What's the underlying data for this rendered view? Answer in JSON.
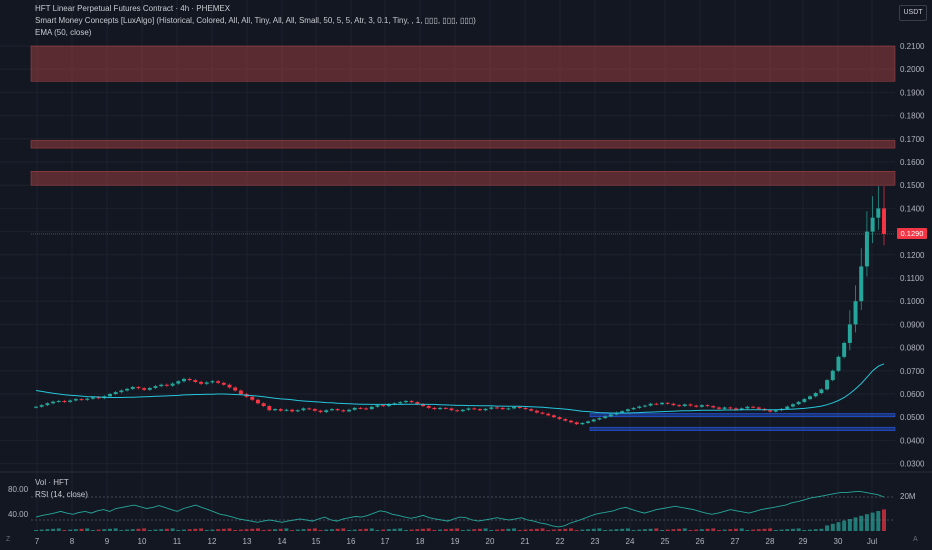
{
  "header": {
    "title": "HFT Linear Perpetual Futures Contract · 4h · PHEMEX",
    "indicator_1": "Smart Money Concepts [LuxAlgo] (Historical, Colored, All, All, Tiny, All, All, Small, 50, 5, 5, Atr, 3, 0.1, Tiny, , 1, ▯▯▯, ▯▯▯, ▯▯▯)",
    "indicator_2": "EMA (50, close)"
  },
  "currency_button": "USDT",
  "last_price": "0.1290",
  "price_axis": [
    "0.2100",
    "0.2000",
    "0.1900",
    "0.1800",
    "0.1700",
    "0.1600",
    "0.1500",
    "0.1400",
    "0.1300",
    "0.1200",
    "0.1100",
    "0.1000",
    "0.0900",
    "0.0800",
    "0.0700",
    "0.0600",
    "0.0500",
    "0.0400",
    "0.0300"
  ],
  "lower_pane": {
    "volume_label": "Vol · HFT",
    "rsi_label": "RSI (14, close)",
    "rsi_levels": [
      "80.00",
      "40.00"
    ],
    "volume_axis_label": "20M"
  },
  "time_axis": [
    "7",
    "8",
    "9",
    "10",
    "11",
    "12",
    "13",
    "14",
    "15",
    "16",
    "17",
    "18",
    "19",
    "20",
    "21",
    "22",
    "23",
    "24",
    "25",
    "26",
    "27",
    "28",
    "29",
    "30",
    "Jul"
  ],
  "corner_left": "Z",
  "corner_right": "A",
  "colors": {
    "background": "#131722",
    "up": "#26a69a",
    "down": "#f23645",
    "ema": "#26c6da",
    "supply_zone": "rgba(178,70,70,0.45)",
    "demand_zone": "rgba(41,98,255,0.4)",
    "rsi": "#26a69a"
  },
  "chart_data": {
    "type": "candlestick",
    "price_range": [
      0.028,
      0.212
    ],
    "closes": [
      0.0545,
      0.0552,
      0.056,
      0.0567,
      0.057,
      0.0566,
      0.0572,
      0.0578,
      0.0575,
      0.058,
      0.0586,
      0.0582,
      0.059,
      0.06,
      0.0608,
      0.0615,
      0.0622,
      0.063,
      0.0625,
      0.0618,
      0.0626,
      0.0634,
      0.064,
      0.0636,
      0.0645,
      0.0655,
      0.0665,
      0.066,
      0.0652,
      0.0644,
      0.065,
      0.0655,
      0.0648,
      0.064,
      0.0628,
      0.0615,
      0.06,
      0.0588,
      0.0575,
      0.056,
      0.0548,
      0.053,
      0.0535,
      0.0528,
      0.0532,
      0.0525,
      0.053,
      0.0538,
      0.0535,
      0.0528,
      0.0522,
      0.053,
      0.0535,
      0.053,
      0.0525,
      0.0532,
      0.054,
      0.0538,
      0.0535,
      0.0545,
      0.0552,
      0.0548,
      0.0556,
      0.056,
      0.0565,
      0.057,
      0.0565,
      0.0556,
      0.0548,
      0.054,
      0.0535,
      0.054,
      0.0538,
      0.053,
      0.0526,
      0.0532,
      0.0538,
      0.0535,
      0.053,
      0.0536,
      0.0542,
      0.054,
      0.0535,
      0.0538,
      0.0544,
      0.054,
      0.0535,
      0.0528,
      0.052,
      0.0515,
      0.0508,
      0.05,
      0.0492,
      0.0485,
      0.0478,
      0.047,
      0.0475,
      0.0482,
      0.049,
      0.0496,
      0.0504,
      0.0512,
      0.052,
      0.0526,
      0.0534,
      0.054,
      0.0546,
      0.055,
      0.0558,
      0.0556,
      0.0562,
      0.0558,
      0.0552,
      0.0548,
      0.0555,
      0.055,
      0.0545,
      0.0552,
      0.0548,
      0.0542,
      0.0536,
      0.0542,
      0.0538,
      0.0532,
      0.0538,
      0.0545,
      0.0542,
      0.0536,
      0.053,
      0.0524,
      0.053,
      0.0536,
      0.0546,
      0.0556,
      0.0566,
      0.0578,
      0.059,
      0.0604,
      0.062,
      0.066,
      0.07,
      0.076,
      0.082,
      0.09,
      0.1,
      0.115,
      0.13,
      0.136,
      0.14,
      0.129
    ],
    "ema": [
      0.0615,
      0.0611,
      0.0607,
      0.0603,
      0.06,
      0.0597,
      0.0595,
      0.0593,
      0.0591,
      0.0589,
      0.0588,
      0.0587,
      0.0586,
      0.0585,
      0.0585,
      0.0585,
      0.0586,
      0.0586,
      0.0587,
      0.0588,
      0.0589,
      0.059,
      0.0591,
      0.0592,
      0.0593,
      0.0594,
      0.0596,
      0.0597,
      0.0598,
      0.0598,
      0.0599,
      0.0599,
      0.06,
      0.06,
      0.0599,
      0.0598,
      0.0597,
      0.0595,
      0.0593,
      0.0591,
      0.0588,
      0.0585,
      0.0582,
      0.0579,
      0.0577,
      0.0575,
      0.0572,
      0.057,
      0.0568,
      0.0567,
      0.0565,
      0.0563,
      0.0562,
      0.056,
      0.0559,
      0.0558,
      0.0557,
      0.0556,
      0.0556,
      0.0555,
      0.0555,
      0.0555,
      0.0555,
      0.0555,
      0.0555,
      0.0556,
      0.0556,
      0.0556,
      0.0556,
      0.0555,
      0.0555,
      0.0554,
      0.0553,
      0.0552,
      0.0551,
      0.0551,
      0.055,
      0.055,
      0.0549,
      0.0549,
      0.0549,
      0.0548,
      0.0548,
      0.0547,
      0.0547,
      0.0547,
      0.0546,
      0.0545,
      0.0544,
      0.0543,
      0.0541,
      0.0539,
      0.0537,
      0.0535,
      0.0532,
      0.0529,
      0.0526,
      0.0524,
      0.0522,
      0.052,
      0.0519,
      0.0518,
      0.0518,
      0.0518,
      0.0518,
      0.0519,
      0.052,
      0.0521,
      0.0522,
      0.0523,
      0.0524,
      0.0525,
      0.0526,
      0.0527,
      0.0528,
      0.0528,
      0.0529,
      0.053,
      0.053,
      0.053,
      0.053,
      0.0531,
      0.0531,
      0.0531,
      0.0532,
      0.0532,
      0.0532,
      0.0532,
      0.0532,
      0.0532,
      0.0532,
      0.0533,
      0.0534,
      0.0535,
      0.0536,
      0.0538,
      0.0541,
      0.0544,
      0.0548,
      0.0554,
      0.0562,
      0.0572,
      0.0585,
      0.0602,
      0.0622,
      0.0645,
      0.0672,
      0.07,
      0.072,
      0.073
    ],
    "zones": [
      {
        "kind": "supply",
        "top": 0.21,
        "bottom": 0.1948
      },
      {
        "kind": "supply",
        "top": 0.1693,
        "bottom": 0.166
      },
      {
        "kind": "supply",
        "top": 0.156,
        "bottom": 0.15
      },
      {
        "kind": "demand",
        "top": 0.0516,
        "bottom": 0.0502
      },
      {
        "kind": "demand",
        "top": 0.0457,
        "bottom": 0.0442
      }
    ],
    "rsi": [
      45,
      48,
      50,
      52,
      55,
      52,
      50,
      53,
      55,
      52,
      56,
      58,
      55,
      60,
      62,
      64,
      66,
      63,
      60,
      62,
      65,
      62,
      58,
      55,
      60,
      63,
      66,
      62,
      58,
      54,
      50,
      48,
      45,
      42,
      40,
      38,
      36,
      38,
      40,
      38,
      36,
      38,
      40,
      42,
      40,
      38,
      42,
      45,
      40,
      38,
      42,
      44,
      46,
      45,
      48,
      52,
      56,
      54,
      50,
      48,
      45,
      43,
      45,
      48,
      44,
      42,
      40,
      38,
      42,
      45,
      44,
      40,
      38,
      40,
      42,
      44,
      42,
      40,
      42,
      44,
      40,
      38,
      35,
      33,
      30,
      28,
      30,
      35,
      38,
      42,
      46,
      50,
      52,
      54,
      56,
      60,
      62,
      58,
      55,
      52,
      55,
      58,
      60,
      62,
      64,
      62,
      60,
      58,
      55,
      52,
      50,
      52,
      55,
      58,
      56,
      54,
      52,
      55,
      58,
      60,
      62,
      64,
      66,
      70,
      72,
      75,
      78,
      80,
      82,
      84,
      86,
      88,
      88,
      89,
      90,
      88,
      86,
      84,
      80
    ]
  }
}
